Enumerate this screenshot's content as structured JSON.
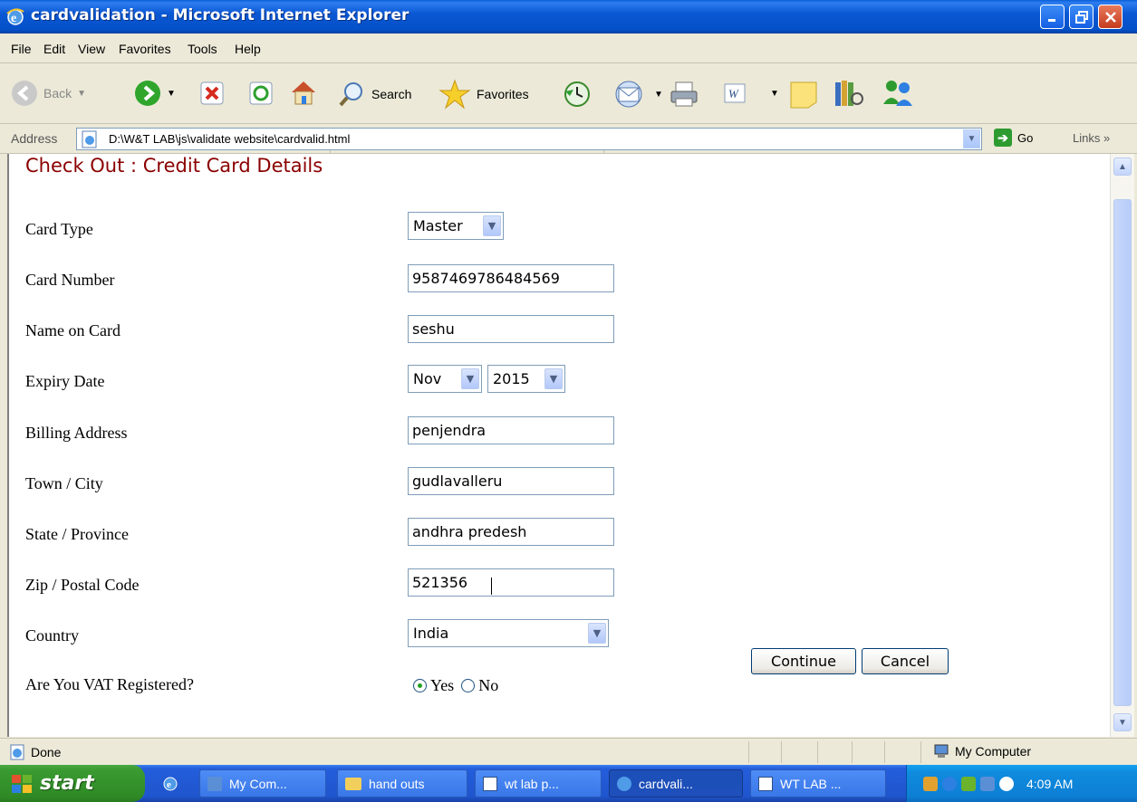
{
  "window": {
    "title": "cardvalidation - Microsoft Internet Explorer"
  },
  "menubar": [
    "File",
    "Edit",
    "View",
    "Favorites",
    "Tools",
    "Help"
  ],
  "toolbar": {
    "back_label": "Back",
    "search_label": "Search",
    "favorites_label": "Favorites"
  },
  "address": {
    "label": "Address",
    "url": "D:\\W&T LAB\\js\\validate website\\cardvalid.html",
    "go_label": "Go",
    "links_label": "Links"
  },
  "form": {
    "title": "Check Out : Credit Card Details",
    "card_type_label": "Card Type",
    "card_type_value": "Master",
    "card_number_label": "Card Number",
    "card_number_value": "9587469786484569",
    "name_label": "Name on Card",
    "name_value": "seshu",
    "expiry_label": "Expiry Date",
    "expiry_month": "Nov",
    "expiry_year": "2015",
    "billing_label": "Billing Address",
    "billing_value": "penjendra",
    "town_label": "Town / City",
    "town_value": "gudlavalleru",
    "state_label": "State / Province",
    "state_value": "andhra predesh",
    "zip_label": "Zip / Postal Code",
    "zip_value": "521356",
    "country_label": "Country",
    "country_value": "India",
    "vat_label": "Are You VAT Registered?",
    "vat_yes": "Yes",
    "vat_no": "No",
    "vat_selected": "Yes",
    "continue_label": "Continue",
    "cancel_label": "Cancel"
  },
  "status": {
    "text": "Done",
    "zone": "My Computer"
  },
  "taskbar": {
    "start_label": "start",
    "tasks": [
      "My Com...",
      "hand outs",
      "wt lab p...",
      "cardvali...",
      "WT LAB ..."
    ],
    "clock": "4:09 AM"
  },
  "colors": {
    "title_red": "#8b0000",
    "titlebar_blue": "#0450c8",
    "start_green": "#3a9a31"
  }
}
